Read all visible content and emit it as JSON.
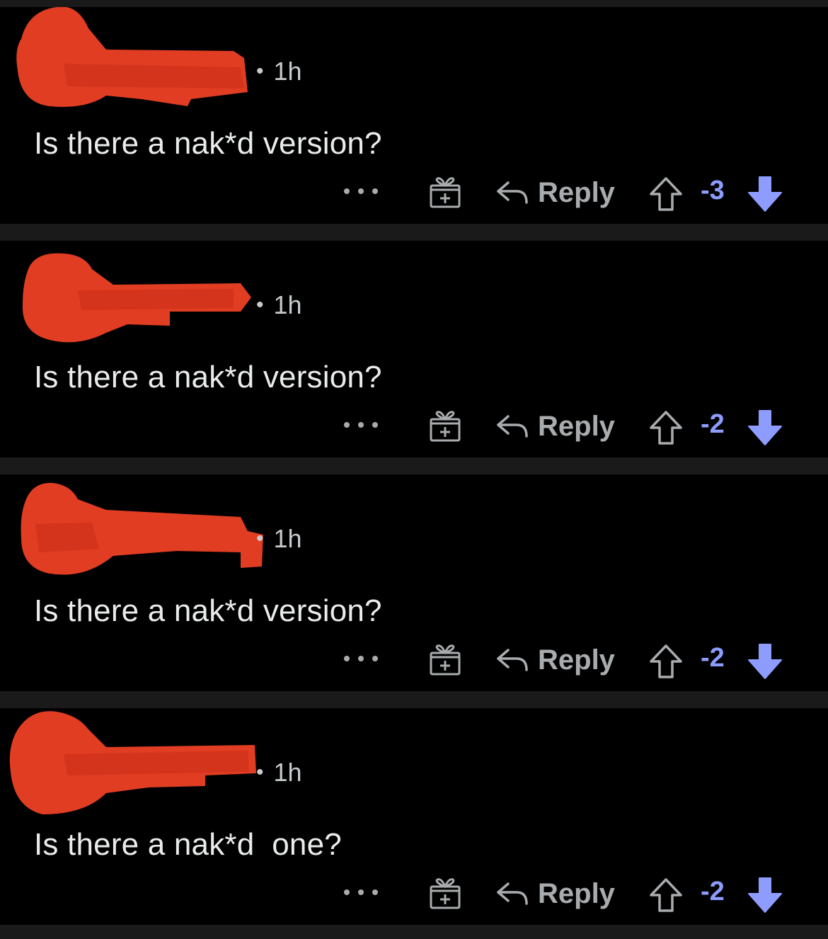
{
  "colors": {
    "background": "#000000",
    "separator": "#1a1a1b",
    "text": "#e9ebec",
    "muted": "#a9acae",
    "downvote": "#8e9cff",
    "redaction": "#e03d22"
  },
  "icons": {
    "more": "more-dots-icon",
    "award": "gift-icon",
    "reply": "reply-arrow-icon",
    "upvote": "upvote-arrow-icon",
    "downvote": "downvote-arrow-icon"
  },
  "comments": [
    {
      "time": "1h",
      "body": "Is there a nak*d version?",
      "reply_label": "Reply",
      "score": "-3"
    },
    {
      "time": "1h",
      "body": "Is there a nak*d version?",
      "reply_label": "Reply",
      "score": "-2"
    },
    {
      "time": "1h",
      "body": "Is there a nak*d version?",
      "reply_label": "Reply",
      "score": "-2"
    },
    {
      "time": "1h",
      "body": "Is there a nak*d  one?",
      "reply_label": "Reply",
      "score": "-2"
    }
  ]
}
